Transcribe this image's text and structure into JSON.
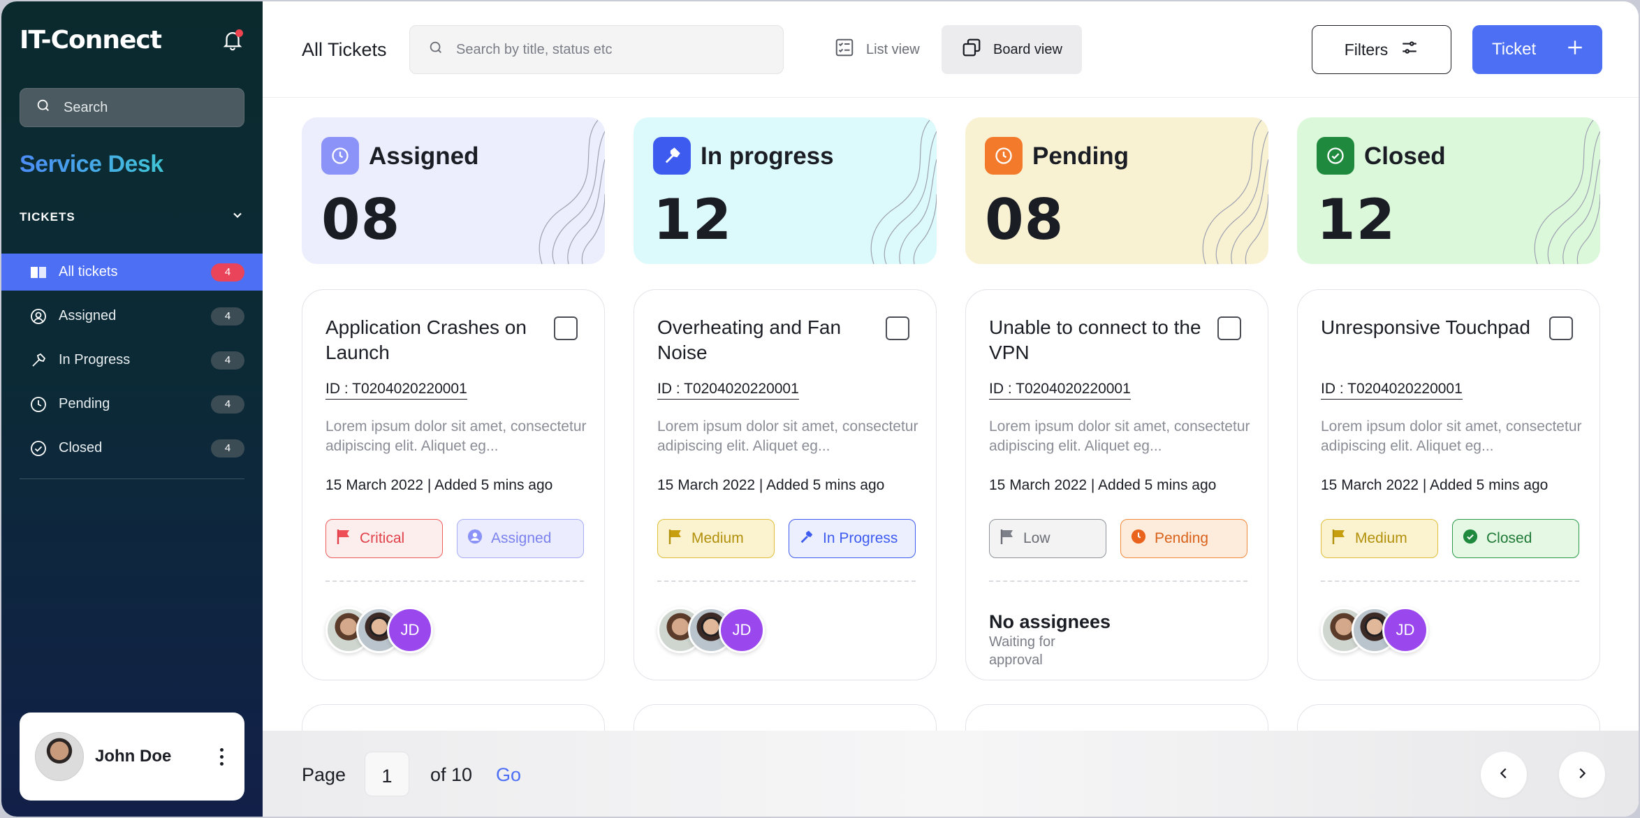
{
  "app": {
    "title": "IT-Connect"
  },
  "sidebar": {
    "search_placeholder": "Search",
    "section_title": "Service Desk",
    "group_label": "TICKETS",
    "items": [
      {
        "label": "All tickets",
        "count": "4",
        "icon": "ticket-icon"
      },
      {
        "label": "Assigned",
        "count": "4",
        "icon": "user-circle-icon"
      },
      {
        "label": "In Progress",
        "count": "4",
        "icon": "hammer-icon"
      },
      {
        "label": "Pending",
        "count": "4",
        "icon": "clock-icon"
      },
      {
        "label": "Closed",
        "count": "4",
        "icon": "check-circle-icon"
      }
    ],
    "user": {
      "name": "John Doe"
    }
  },
  "header": {
    "title": "All Tickets",
    "search_placeholder": "Search by title, status etc",
    "list_view": "List view",
    "board_view": "Board view",
    "filters": "Filters",
    "ticket": "Ticket"
  },
  "stats": [
    {
      "label": "Assigned",
      "value": "08",
      "color": "#8b93f8",
      "bg": "#eceefd"
    },
    {
      "label": "In progress",
      "value": "12",
      "color": "#3e5bf0",
      "bg": "#dcfafb"
    },
    {
      "label": "Pending",
      "value": "08",
      "color": "#f37a2b",
      "bg": "#f8f2d3"
    },
    {
      "label": "Closed",
      "value": "12",
      "color": "#1f8a3e",
      "bg": "#dcf8da"
    }
  ],
  "cards": [
    {
      "title": "Application Crashes on Launch",
      "id": "ID : T0204020220001",
      "desc": "Lorem ipsum dolor sit amet, consectetur adipiscing elit. Aliquet eg...",
      "date": "15 March 2022  |  Added 5 mins ago",
      "priority": "Critical",
      "status": "Assigned",
      "assignees": [
        "",
        "",
        "JD"
      ]
    },
    {
      "title": "Overheating and Fan Noise",
      "id": "ID : T0204020220001",
      "desc": "Lorem ipsum dolor sit amet, consectetur adipiscing elit. Aliquet eg...",
      "date": "15 March 2022  |  Added 5 mins ago",
      "priority": "Medium",
      "status": "In Progress",
      "assignees": [
        "",
        "",
        "JD"
      ]
    },
    {
      "title": "Unable to connect to the VPN",
      "id": "ID : T0204020220001",
      "desc": "Lorem ipsum dolor sit amet, consectetur adipiscing elit. Aliquet eg...",
      "date": "15 March 2022  |  Added 5 mins ago",
      "priority": "Low",
      "status": "Pending",
      "no_assignees": "No assignees",
      "waiting": "Waiting for approval"
    },
    {
      "title": "Unresponsive Touchpad",
      "id": "ID : T0204020220001",
      "desc": "Lorem ipsum dolor sit amet, consectetur adipiscing elit. Aliquet eg...",
      "date": "15 March 2022  |  Added 5 mins ago",
      "priority": "Medium",
      "status": "Closed",
      "assignees": [
        "",
        "",
        "JD"
      ]
    }
  ],
  "pager": {
    "label": "Page",
    "current": "1",
    "of": "of 10",
    "go": "Go"
  }
}
